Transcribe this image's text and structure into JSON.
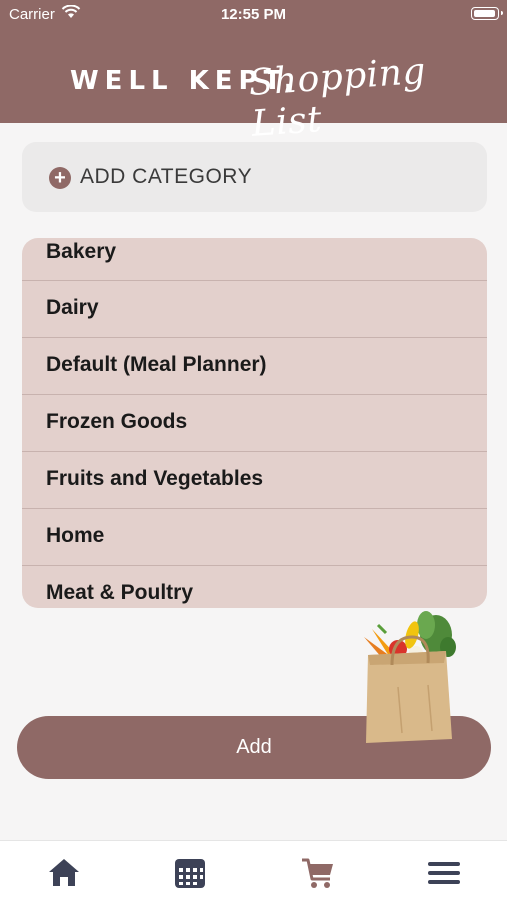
{
  "status": {
    "carrier": "Carrier",
    "time": "12:55 PM",
    "icons": [
      "wifi-icon",
      "battery-icon"
    ]
  },
  "header": {
    "brand_bold": "WELL KEPT,",
    "brand_script": "Shopping List"
  },
  "add_category": {
    "icon": "plus-circle-icon",
    "label": "ADD CATEGORY"
  },
  "categories": [
    "Bakery",
    "Dairy",
    "Default (Meal Planner)",
    "Frozen Goods",
    "Fruits and Vegetables",
    "Home",
    "Meat & Poultry"
  ],
  "add_button": {
    "label": "Add"
  },
  "decoration": {
    "icon": "grocery-bag-illustration"
  },
  "tabbar": {
    "items": [
      {
        "name": "home",
        "icon": "home-icon"
      },
      {
        "name": "calendar",
        "icon": "calendar-icon"
      },
      {
        "name": "cart",
        "icon": "cart-icon"
      },
      {
        "name": "menu",
        "icon": "menu-icon"
      }
    ]
  },
  "colors": {
    "accent": "#8f6966",
    "list_background": "#e3d0cc",
    "tab_icon": "#3d4257"
  }
}
